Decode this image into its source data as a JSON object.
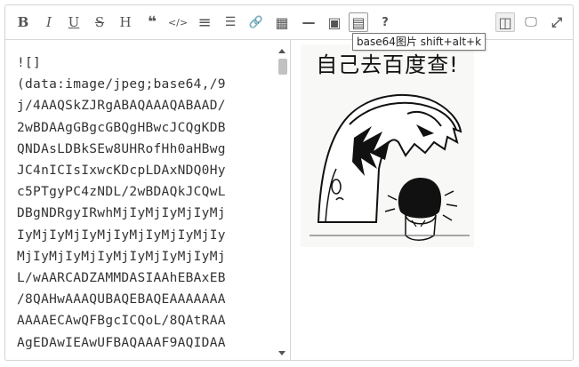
{
  "toolbar": {
    "buttons": [
      {
        "name": "bold-button",
        "glyph": "B"
      },
      {
        "name": "italic-button",
        "glyph": "I"
      },
      {
        "name": "underline-button",
        "glyph": "U"
      },
      {
        "name": "strikethrough-button",
        "glyph": "S"
      },
      {
        "name": "heading-button",
        "glyph": "H"
      },
      {
        "name": "quote-button",
        "glyph": "❝"
      },
      {
        "name": "code-button",
        "glyph": "</>"
      },
      {
        "name": "ordered-list-button",
        "glyph": "≡"
      },
      {
        "name": "unordered-list-button",
        "glyph": "☰"
      },
      {
        "name": "link-button",
        "glyph": "🔗"
      },
      {
        "name": "table-button",
        "glyph": "▦"
      },
      {
        "name": "horizontal-rule-button",
        "glyph": "—"
      },
      {
        "name": "image-button",
        "glyph": "▣"
      },
      {
        "name": "base64-image-button",
        "glyph": "▤"
      },
      {
        "name": "help-button",
        "glyph": "?"
      }
    ],
    "right_buttons": [
      {
        "name": "side-by-side-button",
        "glyph": "◫"
      },
      {
        "name": "preview-button",
        "glyph": "🖵"
      },
      {
        "name": "fullscreen-button",
        "glyph": "⤢"
      }
    ],
    "tooltip": "base64图片 shift+alt+k"
  },
  "editor": {
    "lines": [
      "![]",
      "(data:image/jpeg;base64,/9",
      "j/4AAQSkZJRgABAQAAAQABAAD/",
      "2wBDAAgGBgcGBQgHBwcJCQgKDB",
      "QNDAsLDBkSEw8UHRofHh0aHBwg",
      "JC4nICIsIxwcKDcpLDAxNDQ0Hy",
      "c5PTgyPC4zNDL/2wBDAQkJCQwL",
      "DBgNDRgyIRwhMjIyMjIyMjIyMj",
      "IyMjIyMjIyMjIyMjIyMjIyMjIy",
      "MjIyMjIyMjIyMjIyMjIyMjIyMj",
      "L/wAARCADZAMMDASIAAhEBAxEB",
      "/8QAHwAAAQUBAQEBAQEAAAAAAA",
      "AAAAECAwQFBgcICQoL/8QAtRAA",
      "AgEDAwIEAwUFBAQAAAF9AQIDAA"
    ]
  },
  "preview": {
    "image_caption": "自己去百度查!"
  },
  "colors": {
    "toolbar_icon": "#555555",
    "border": "#d4d4d4",
    "text": "#333333"
  }
}
